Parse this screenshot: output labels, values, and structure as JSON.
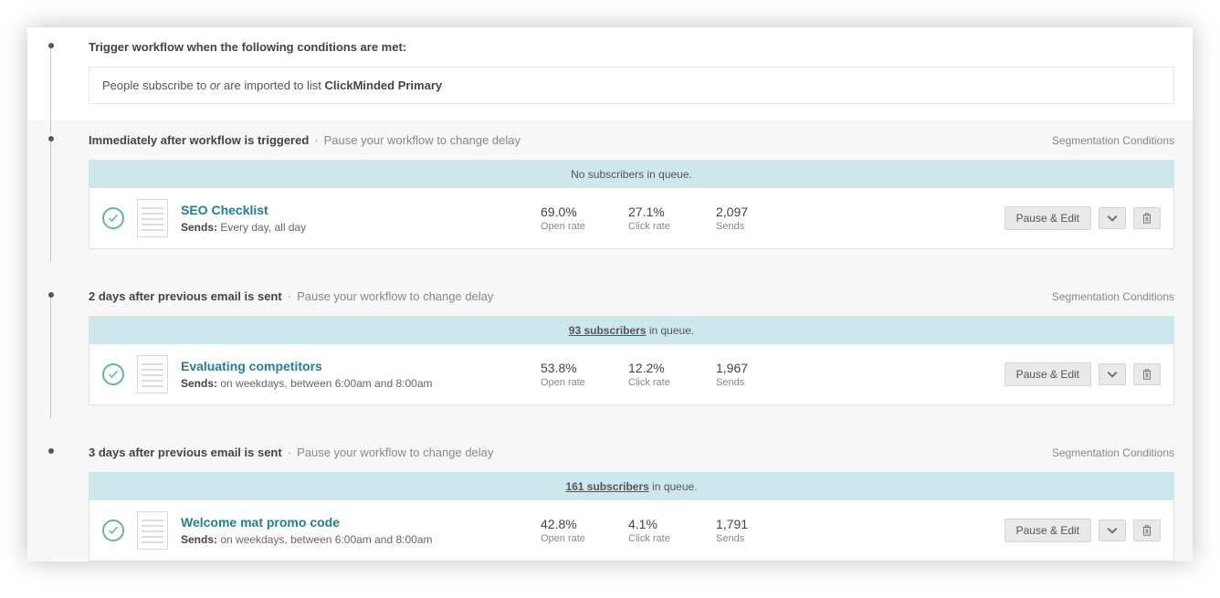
{
  "trigger": {
    "heading": "Trigger workflow when the following conditions are met:",
    "condition_prefix": "People subscribe to ",
    "condition_or": "or",
    "condition_mid": " are imported to list ",
    "condition_list": "ClickMinded Primary"
  },
  "pause_hint": "Pause your workflow to change delay",
  "seg_label": "Segmentation Conditions",
  "buttons": {
    "pause_edit": "Pause & Edit"
  },
  "queue_suffix": " in queue.",
  "open_rate_label": "Open rate",
  "click_rate_label": "Click rate",
  "sends_count_label": "Sends",
  "sends_prefix": "Sends:",
  "steps": [
    {
      "timing": "Immediately after workflow is triggered",
      "queue_text": "No subscribers in queue.",
      "queue_link": "",
      "title": "SEO Checklist",
      "schedule": "Every day, all day",
      "open_rate": "69.0%",
      "click_rate": "27.1%",
      "sends": "2,097"
    },
    {
      "timing": "2 days after previous email is sent",
      "queue_text": "",
      "queue_link": "93 subscribers",
      "title": "Evaluating competitors",
      "schedule": "on weekdays, between 6:00am and 8:00am",
      "open_rate": "53.8%",
      "click_rate": "12.2%",
      "sends": "1,967"
    },
    {
      "timing": "3 days after previous email is sent",
      "queue_text": "",
      "queue_link": "161 subscribers",
      "title": "Welcome mat promo code",
      "schedule": "on weekdays, between 6:00am and 8:00am",
      "open_rate": "42.8%",
      "click_rate": "4.1%",
      "sends": "1,791"
    }
  ]
}
